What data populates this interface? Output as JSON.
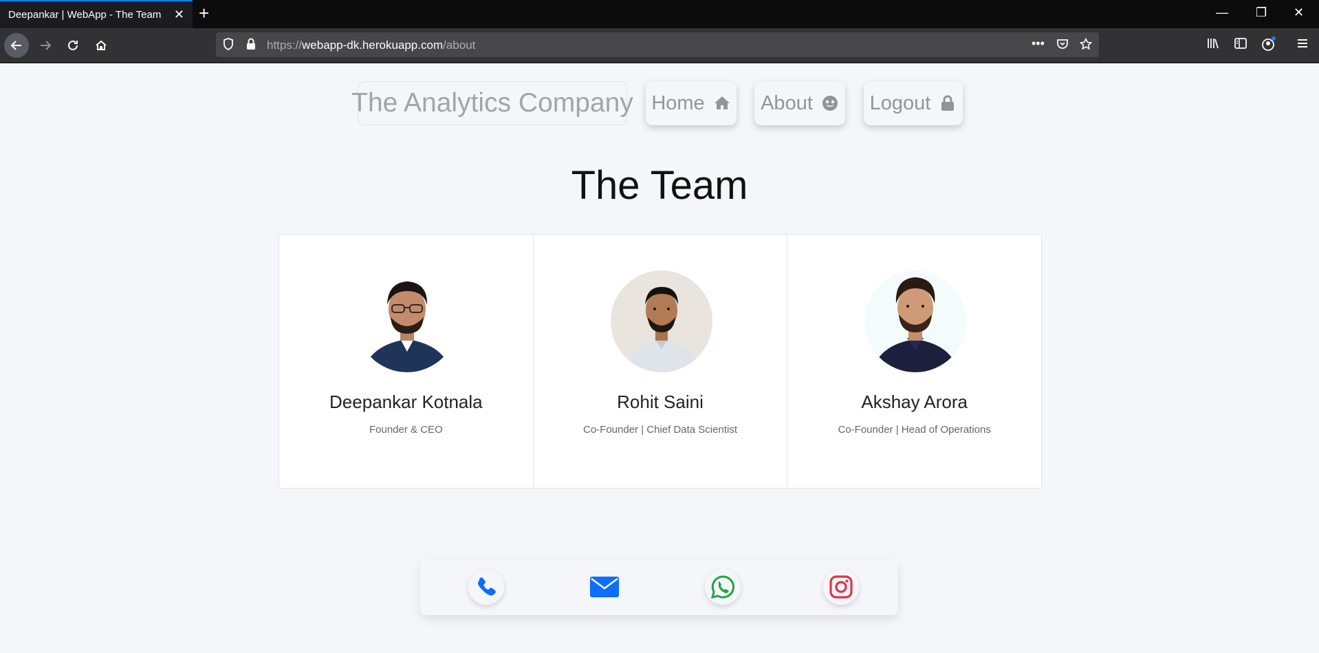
{
  "browser": {
    "tab_title": "Deepankar | WebApp - The Team",
    "tab_close": "✕",
    "new_tab": "+",
    "url_protocol": "https://",
    "url_domain": "webapp-dk.herokuapp.com",
    "url_path": "/about",
    "window_controls": [
      "—",
      "❐",
      "✕"
    ],
    "accent_color": "#0a84ff"
  },
  "nav": {
    "brand": "The Analytics Company",
    "home_label": "Home",
    "home_icon": "home-icon",
    "about_label": "About",
    "about_icon": "face-icon",
    "logout_label": "Logout",
    "logout_icon": "lock-icon"
  },
  "page": {
    "heading": "The Team"
  },
  "team": [
    {
      "name": "Deepankar Kotnala",
      "role": "Founder & CEO",
      "avatar": "profile-photo"
    },
    {
      "name": "Rohit Saini",
      "role": "Co-Founder | Chief Data Scientist",
      "avatar": "profile-photo"
    },
    {
      "name": "Akshay Arora",
      "role": "Co-Founder | Head of Operations",
      "avatar": "profile-photo"
    }
  ],
  "contact": {
    "icons": [
      "phone-icon",
      "email-icon",
      "whatsapp-icon",
      "instagram-icon"
    ],
    "colors": {
      "phone": "#0d6efd",
      "email": "#0d6efd",
      "whatsapp": "#25a244",
      "instagram": "#dc3545"
    }
  }
}
